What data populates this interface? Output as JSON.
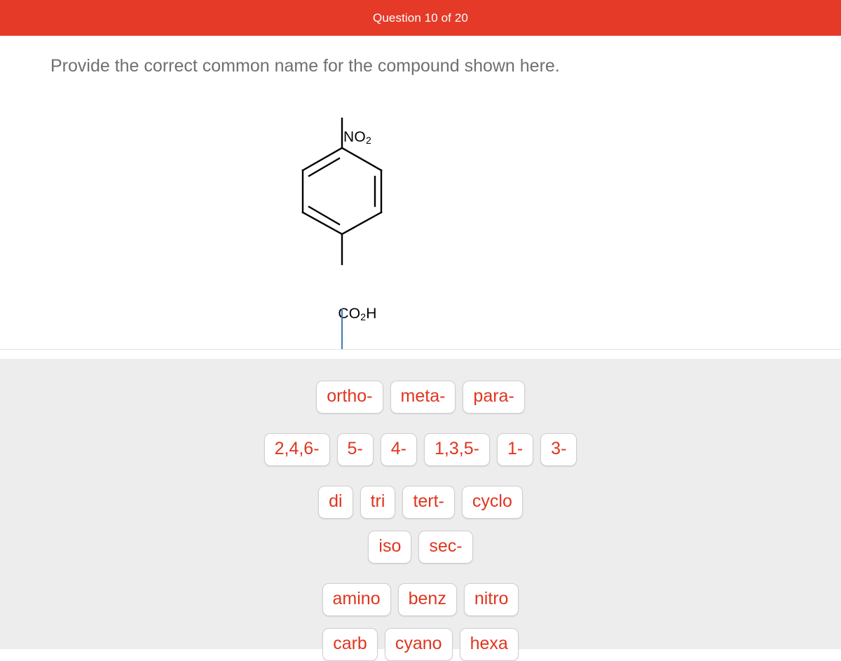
{
  "header": {
    "title": "Question 10 of 20",
    "background_color": "#e53a28",
    "text_color": "#ffffff"
  },
  "question": {
    "prompt": "Provide the correct common name for the compound shown here.",
    "text_color": "#6f6f6f"
  },
  "molecule": {
    "name": "benzene-ring-structure",
    "top_substituent": "NO",
    "top_substituent_sub": "2",
    "bottom_substituent_pre": "CO",
    "bottom_substituent_sub": "2",
    "bottom_substituent_post": "H",
    "bond_color": "#000000"
  },
  "answer_input": {
    "value": "",
    "caret_color": "#3b7cb5"
  },
  "tray": {
    "background_color": "#ededed",
    "tile_text_color": "#e0351f",
    "rows": [
      {
        "tiles": [
          "ortho-",
          "meta-",
          "para-"
        ]
      },
      {
        "tiles": [
          "2,4,6-",
          "5-",
          "4-",
          "1,3,5-",
          "1-",
          "3-"
        ]
      },
      {
        "tiles": [
          "di",
          "tri",
          "tert-",
          "cyclo"
        ]
      },
      {
        "tiles": [
          "iso",
          "sec-"
        ]
      },
      {
        "tiles": [
          "amino",
          "benz",
          "nitro"
        ]
      },
      {
        "tiles": [
          "carb",
          "cyano",
          "hexa"
        ]
      }
    ]
  }
}
